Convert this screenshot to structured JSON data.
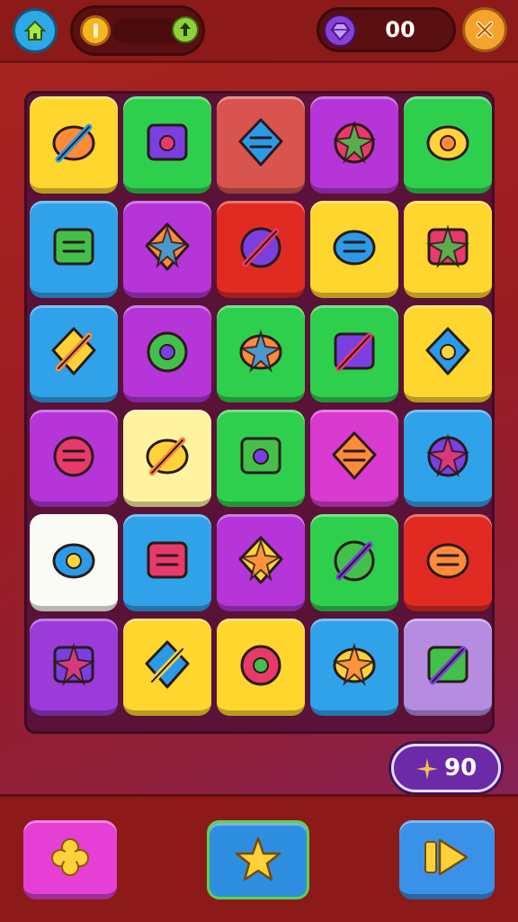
{
  "header": {
    "home_icon": "home-icon",
    "coin_icon": "coin-icon",
    "coin_add_icon": "plus-icon",
    "gem_icon": "gem-icon",
    "gem_count": "00",
    "close_icon": "close-icon"
  },
  "board": {
    "rows": 6,
    "cols": 5,
    "tiles": [
      {
        "icon": "ice-cream-cone-icon",
        "color": "#ffd62e"
      },
      {
        "icon": "pencil-square-icon",
        "color": "#2fcf4e"
      },
      {
        "icon": "paint-jar-brush-icon",
        "color": "#d9534f"
      },
      {
        "icon": "crab-ball-icon",
        "color": "#b535d9"
      },
      {
        "icon": "orange-box-icon",
        "color": "#2fcf4e"
      },
      {
        "icon": "pencil-frame-icon",
        "color": "#2fa2ea"
      },
      {
        "icon": "goggles-icon",
        "color": "#b535d9"
      },
      {
        "icon": "target-brush-icon",
        "color": "#e12b22"
      },
      {
        "icon": "helmet-jar-icon",
        "color": "#ffd62e"
      },
      {
        "icon": "gift-box-icon",
        "color": "#ffd62e"
      },
      {
        "icon": "donut-ring-icon",
        "color": "#2fa2ea"
      },
      {
        "icon": "tag-label-icon",
        "color": "#b535d9"
      },
      {
        "icon": "orange-fruit-icon",
        "color": "#2fcf4e"
      },
      {
        "icon": "purple-leaf-icon",
        "color": "#2fcf4e"
      },
      {
        "icon": "palm-tree-icon",
        "color": "#ffd62e"
      },
      {
        "icon": "cookie-blob-icon",
        "color": "#b535d9"
      },
      {
        "icon": "green-gem-icon",
        "color": "#fff3a0"
      },
      {
        "icon": "purple-rocket-icon",
        "color": "#2fcf4e"
      },
      {
        "icon": "spiky-star-icon",
        "color": "#d93ad0"
      },
      {
        "icon": "paint-brush-icon",
        "color": "#2fa2ea"
      },
      {
        "icon": "blue-button-icon",
        "color": "#fbfbf5"
      },
      {
        "icon": "robot-box-icon",
        "color": "#2fa2ea"
      },
      {
        "icon": "paper-arrow-icon",
        "color": "#b535d9"
      },
      {
        "icon": "blue-orb-icon",
        "color": "#2fcf4e"
      },
      {
        "icon": "lime-slice-icon",
        "color": "#e12b22"
      },
      {
        "icon": "rainbow-brush-icon",
        "color": "#9b3bd9"
      },
      {
        "icon": "robot-face-icon",
        "color": "#ffd62e"
      },
      {
        "icon": "paint-palette-icon",
        "color": "#ffd62e"
      },
      {
        "icon": "purple-shell-icon",
        "color": "#2fa2ea"
      },
      {
        "icon": "blue-robot-jar-icon",
        "color": "#b58ce0"
      }
    ]
  },
  "score": {
    "icon": "sparkle-icon",
    "value": "90"
  },
  "footer": {
    "left_button_icon": "puzzle-flower-icon",
    "center_button_icon": "star-icon",
    "right_button_icon": "play-arrow-icon"
  },
  "colors": {
    "background": "#9a1d22",
    "bar": "#8c1a18",
    "board": "#5a1238"
  }
}
